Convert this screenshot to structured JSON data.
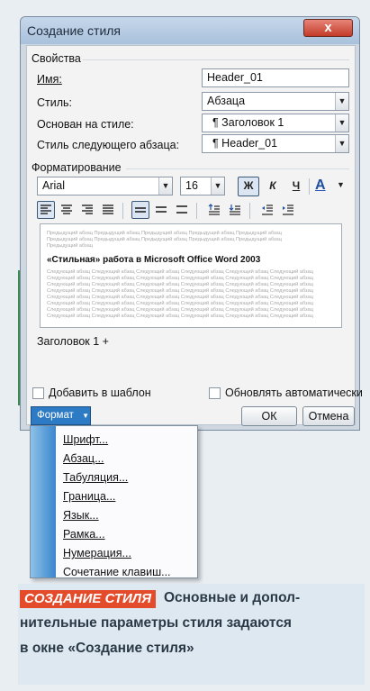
{
  "dialog": {
    "title": "Создание стиля",
    "close_glyph": "x",
    "properties_label": "Свойства",
    "name_label": "Имя:",
    "name_value": "Header_01",
    "style_label": "Стиль:",
    "style_value": "Абзаца",
    "based_on_label": "Основан на стиле:",
    "based_on_value": "¶ Заголовок 1",
    "next_style_label": "Стиль следующего абзаца:",
    "next_style_value": "¶ Header_01",
    "formatting_label": "Форматирование",
    "font_value": "Arial",
    "size_value": "16",
    "bold_glyph": "Ж",
    "italic_glyph": "К",
    "underline_glyph": "Ч",
    "color_glyph": "А",
    "preview_prev_text": "Предыдущий абзац Предыдущий абзац Предыдущий абзац Предыдущий абзац Предыдущий абзац",
    "preview_prev_short": "Предыдущий абзац",
    "preview_sample": "«Стильная» работа в Microsoft Office Word 2003",
    "preview_next_text": "Следующий абзац Следующий абзац Следующий абзац Следующий абзац Следующий абзац Следующий абзац",
    "description": "Заголовок 1 +",
    "add_to_template_label": "Добавить в шаблон",
    "auto_update_label": "Обновлять автоматически",
    "format_button_label": "Формат",
    "ok_label": "ОК",
    "cancel_label": "Отмена"
  },
  "format_menu": {
    "items": [
      "Шрифт...",
      "Абзац...",
      "Табуляция...",
      "Граница...",
      "Язык...",
      "Рамка...",
      "Нумерация...",
      "Сочетание клавиш..."
    ]
  },
  "caption": {
    "tag": "СОЗДАНИЕ СТИЛЯ",
    "line1": "Основные и допол-",
    "line2": "нительные параметры стиля задаются",
    "line3": "в окне «Создание стиля»"
  },
  "colors": {
    "accent": "#e34b2a",
    "menu_blue": "#2e7bc5"
  }
}
